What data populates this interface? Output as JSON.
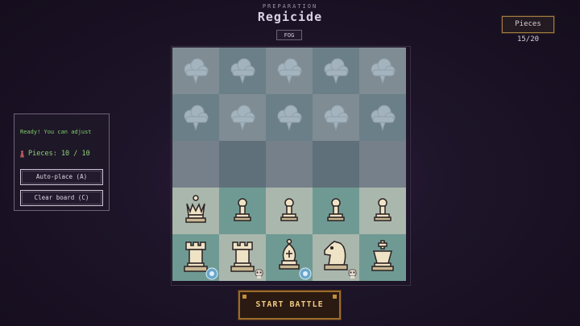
{
  "header": {
    "subtitle": "PREPARATION",
    "title": "Regicide",
    "mode_tag": "FOG"
  },
  "counter": {
    "label": "Pieces 15/20"
  },
  "panel": {
    "status": "Ready! You can adjust",
    "pieces_label": "Pieces: 10 / 10",
    "buttons": {
      "auto_place": "Auto-place (A)",
      "clear_board": "Clear board (C)"
    }
  },
  "board": {
    "rows": [
      [
        "fog",
        "fog",
        "fog",
        "fog",
        "fog"
      ],
      [
        "fog",
        "fog",
        "fog",
        "fog",
        "fog"
      ],
      [
        "empty",
        "empty",
        "empty",
        "empty",
        "empty"
      ],
      [
        "queen",
        "pawn",
        "pawn",
        "pawn",
        "pawn"
      ],
      [
        "rook",
        "rook",
        "bishop",
        "knight",
        "king"
      ]
    ],
    "back_row_badges": [
      "frost",
      "skull",
      "frost",
      "skull",
      ""
    ]
  },
  "actions": {
    "start": "START BATTLE"
  },
  "colors": {
    "accent_gold": "#c58d3c",
    "ready_green": "#7fce6a"
  }
}
